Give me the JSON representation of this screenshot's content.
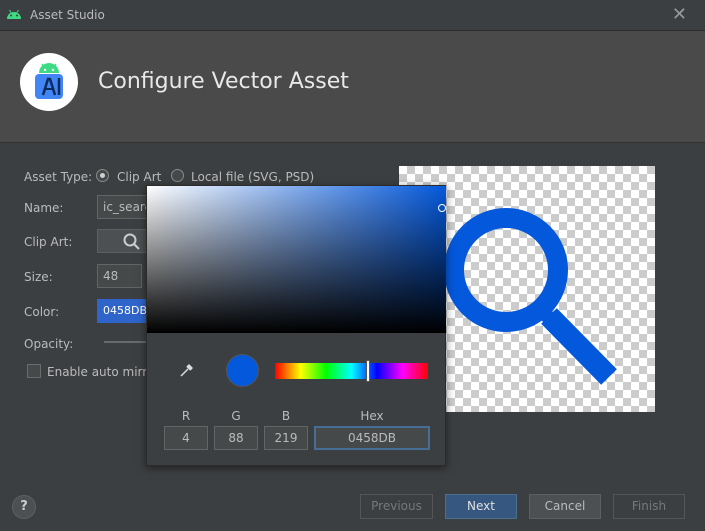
{
  "window": {
    "title": "Asset Studio",
    "close": "✕"
  },
  "header": {
    "title": "Configure Vector Asset"
  },
  "form": {
    "asset_type_label": "Asset Type:",
    "asset_type_options": [
      "Clip Art",
      "Local file (SVG, PSD)"
    ],
    "asset_type_selected": "Clip Art",
    "name_label": "Name:",
    "name_value": "ic_searc",
    "clip_art_label": "Clip Art:",
    "size_label": "Size:",
    "size_value": "48",
    "color_label": "Color:",
    "color_value": "0458DB",
    "opacity_label": "Opacity:",
    "auto_mirror_label": "Enable auto mirror"
  },
  "color_picker": {
    "current_color": "#0458DB",
    "channels": [
      {
        "label": "R",
        "value": "4"
      },
      {
        "label": "G",
        "value": "88"
      },
      {
        "label": "B",
        "value": "219"
      },
      {
        "label": "Hex",
        "value": "0458DB"
      }
    ]
  },
  "preview": {
    "icon": "search-icon",
    "color": "#0458DB"
  },
  "footer": {
    "help": "?",
    "buttons": [
      {
        "label": "Previous",
        "enabled": false
      },
      {
        "label": "Next",
        "enabled": true
      },
      {
        "label": "Cancel",
        "enabled": true
      },
      {
        "label": "Finish",
        "enabled": false
      }
    ]
  }
}
